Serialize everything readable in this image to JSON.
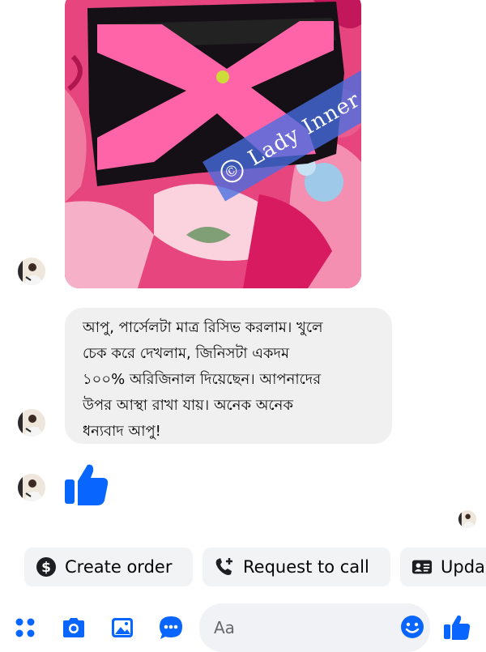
{
  "photo": {
    "watermark": "Lady Inner",
    "watermark_symbol": "©"
  },
  "message": {
    "lines": [
      "আপু, পার্সেলটা মাত্র রিসিভ করলাম। খুলে",
      "চেক করে দেখলাম, জিনিসটা একদম",
      "১০০% অরিজিনাল দিয়েছেন। আপনাদের",
      "উপর আস্থা রাখা যায়। অনেক অনেক",
      "ধন্যবাদ আপু!"
    ]
  },
  "quick_replies": {
    "create_order": "Create order",
    "request_call": "Request to call",
    "update": "Upda"
  },
  "composer": {
    "placeholder": "Aa"
  },
  "colors": {
    "accent": "#0866ff",
    "bubble": "#f0f0f0",
    "chip": "#f2f3f5"
  },
  "icons": [
    "menu-dots-icon",
    "camera-icon",
    "gallery-icon",
    "chat-bubble-icon",
    "emoji-icon",
    "like-icon",
    "dollar-icon",
    "phone-plus-icon",
    "contact-card-icon"
  ]
}
